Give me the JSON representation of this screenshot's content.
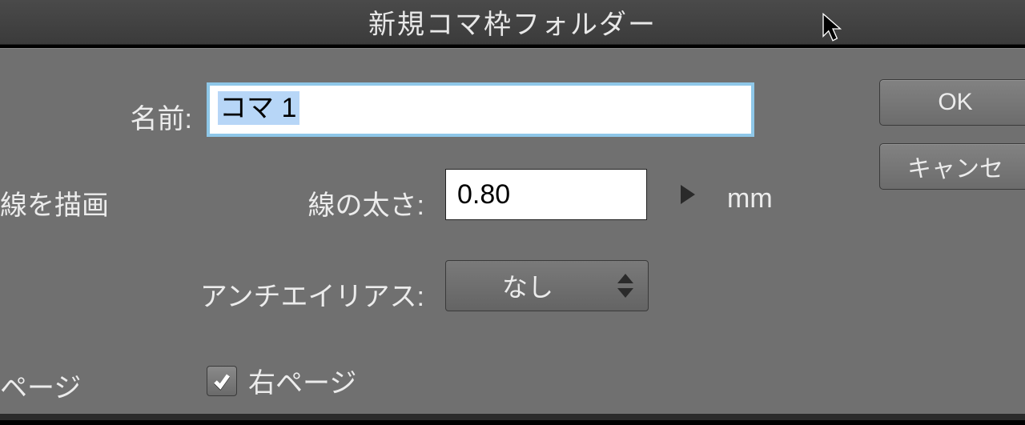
{
  "title": "新規コマ枠フォルダー",
  "labels": {
    "name": "名前:",
    "drawLine": "線を描画",
    "thickness": "線の太さ:",
    "unit": "mm",
    "antialias": "アンチエイリアス:",
    "pageLeft": "ページ",
    "rightPage": "右ページ"
  },
  "values": {
    "name": "コマ 1",
    "thickness": "0.80",
    "antialias": "なし",
    "rightPageChecked": true
  },
  "buttons": {
    "ok": "OK",
    "cancel": "キャンセ"
  }
}
